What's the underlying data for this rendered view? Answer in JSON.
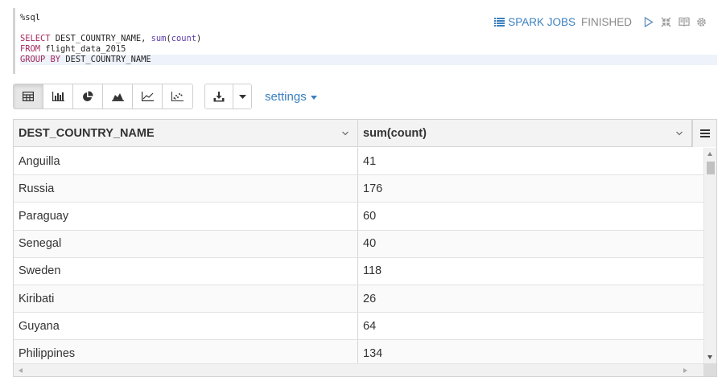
{
  "editor": {
    "lines": [
      [
        {
          "t": "%sql",
          "c": "plain"
        }
      ],
      [],
      [
        {
          "t": "SELECT",
          "c": "kw"
        },
        {
          "t": " DEST_COUNTRY_NAME, ",
          "c": "plain"
        },
        {
          "t": "sum",
          "c": "fn"
        },
        {
          "t": "(",
          "c": "plain"
        },
        {
          "t": "count",
          "c": "fn"
        },
        {
          "t": ")",
          "c": "plain"
        }
      ],
      [
        {
          "t": "FROM",
          "c": "kw"
        },
        {
          "t": " flight_data_2015",
          "c": "plain"
        }
      ],
      [
        {
          "t": "GROUP",
          "c": "kw"
        },
        {
          "t": " ",
          "c": "plain"
        },
        {
          "t": "BY",
          "c": "kw"
        },
        {
          "t": " DEST_COUNTRY_NAME",
          "c": "plain"
        }
      ]
    ]
  },
  "paragraph": {
    "spark_jobs_label": "SPARK JOBS",
    "status": "FINISHED",
    "icons": [
      "spark-jobs-icon",
      "run-icon",
      "collapse-icon",
      "book-icon",
      "gear-icon"
    ]
  },
  "toolbar": {
    "view_buttons": [
      {
        "name": "table-view-button",
        "icon": "table-icon",
        "active": true
      },
      {
        "name": "bar-chart-button",
        "icon": "bar-chart-icon",
        "active": false
      },
      {
        "name": "pie-chart-button",
        "icon": "pie-chart-icon",
        "active": false
      },
      {
        "name": "area-chart-button",
        "icon": "area-chart-icon",
        "active": false
      },
      {
        "name": "line-chart-button",
        "icon": "line-chart-icon",
        "active": false
      },
      {
        "name": "scatter-chart-button",
        "icon": "scatter-chart-icon",
        "active": false
      }
    ],
    "settings_label": "settings"
  },
  "table": {
    "columns": [
      "DEST_COUNTRY_NAME",
      "sum(count)"
    ],
    "rows": [
      [
        "Anguilla",
        "41"
      ],
      [
        "Russia",
        "176"
      ],
      [
        "Paraguay",
        "60"
      ],
      [
        "Senegal",
        "40"
      ],
      [
        "Sweden",
        "118"
      ],
      [
        "Kiribati",
        "26"
      ],
      [
        "Guyana",
        "64"
      ],
      [
        "Philippines",
        "134"
      ]
    ]
  },
  "colors": {
    "link": "#3a7fbf",
    "keyword": "#a3285c",
    "function": "#5c3ca6"
  }
}
